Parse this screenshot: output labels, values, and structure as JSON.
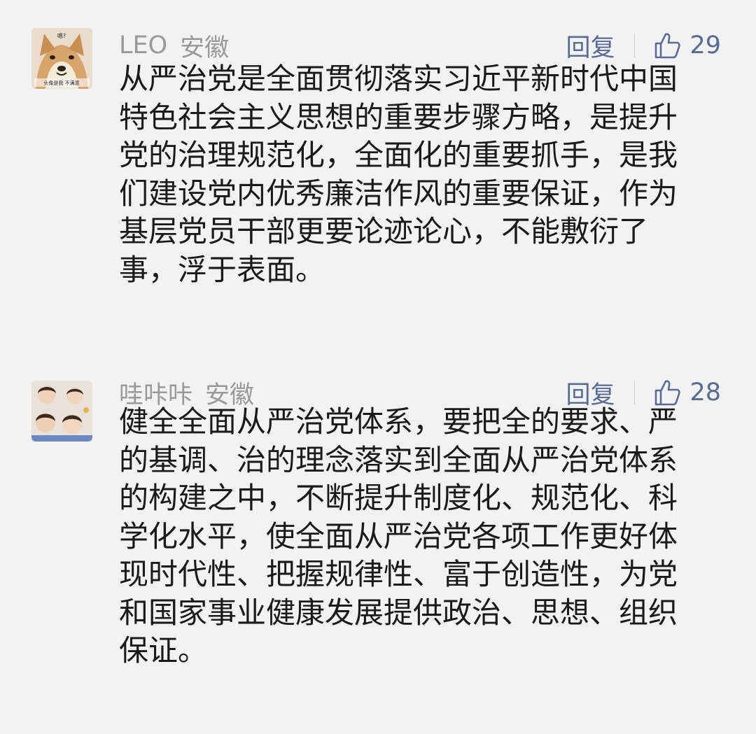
{
  "comments": [
    {
      "name": "LEO",
      "location": "安徽",
      "reply": "回复",
      "likes": "29",
      "avatar_caption_top": "嗯?",
      "avatar_caption_bottom": "头像是我 不满意",
      "lines": [
        "从严治党是全面贯彻落实习近平新时代中国",
        "特色社会主义思想的重要步骤方略，是提升",
        "党的治理规范化，全面化的重要抓手，是我",
        "们建设党内优秀廉洁作风的重要保证，作为",
        "基层党员干部更要论迹论心，不能敷衍了",
        "事，浮于表面。"
      ]
    },
    {
      "name": "哇咔咔",
      "location": "安徽",
      "reply": "回复",
      "likes": "28",
      "lines": [
        "健全全面从严治党体系，要把全的要求、严",
        "的基调、治的理念落实到全面从严治党体系",
        "的构建之中，不断提升制度化、规范化、科",
        "学化水平，使全面从严治党各项工作更好体",
        "现时代性、把握规律性、富于创造性，为党",
        "和国家事业健康发展提供政治、思想、组织",
        "保证。"
      ]
    }
  ]
}
